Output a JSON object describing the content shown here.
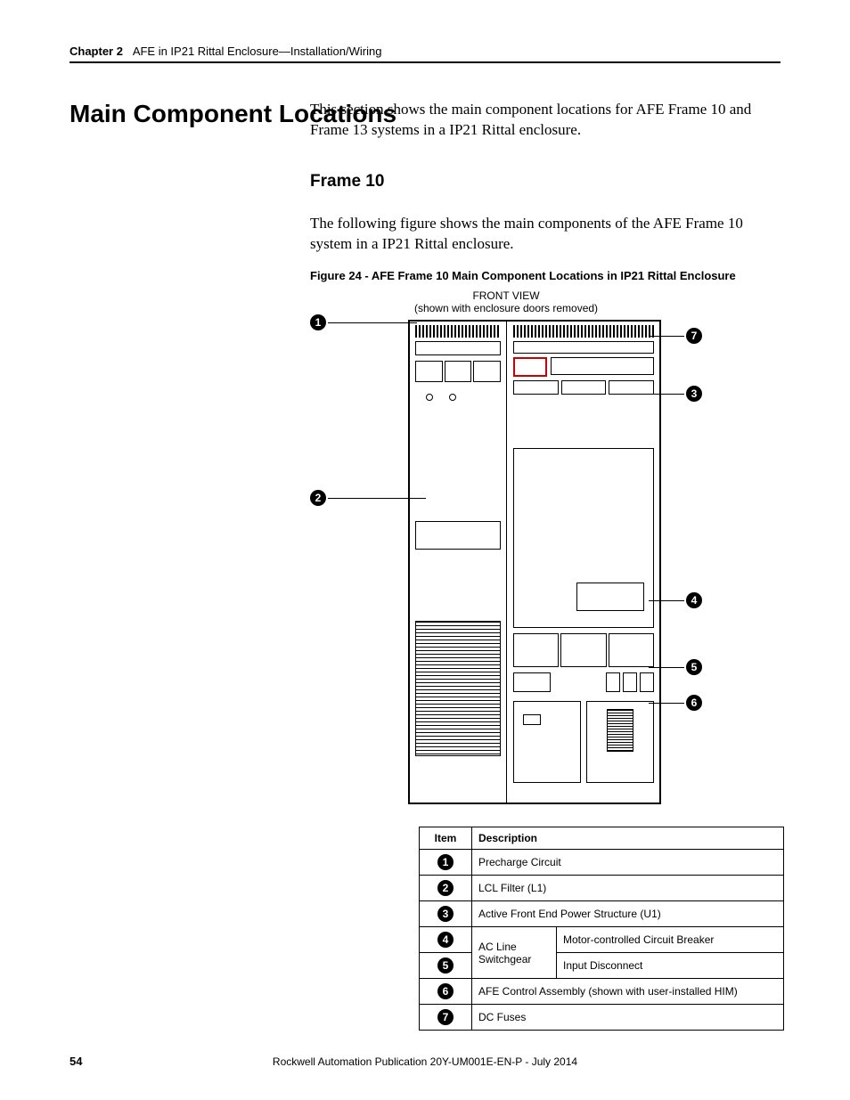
{
  "header": {
    "chapter_label": "Chapter 2",
    "chapter_title": "AFE in IP21 Rittal Enclosure—Installation/Wiring"
  },
  "section_title": "Main Component Locations",
  "intro_text": "This section shows the main component locations for AFE Frame 10 and Frame 13 systems in a IP21 Rittal enclosure.",
  "subsection_title": "Frame 10",
  "subsection_text": "The following figure shows the main components of the AFE Frame 10 system in a IP21 Rittal enclosure.",
  "figure_caption": "Figure 24 - AFE Frame 10 Main Component Locations in IP21 Rittal Enclosure",
  "figure_title": "FRONT VIEW",
  "figure_subtitle": "(shown with enclosure doors removed)",
  "callouts": {
    "c1": "1",
    "c2": "2",
    "c3": "3",
    "c4": "4",
    "c5": "5",
    "c6": "6",
    "c7": "7"
  },
  "table": {
    "headers": {
      "item": "Item",
      "desc": "Description"
    },
    "rows": [
      {
        "n": "1",
        "desc": "Precharge Circuit"
      },
      {
        "n": "2",
        "desc": "LCL Filter (L1)"
      },
      {
        "n": "3",
        "desc": "Active Front End Power Structure (U1)"
      }
    ],
    "switchgear_label": "AC Line Switchgear",
    "row4": {
      "n": "4",
      "desc": "Motor-controlled Circuit Breaker"
    },
    "row5": {
      "n": "5",
      "desc": "Input Disconnect"
    },
    "row6": {
      "n": "6",
      "desc": "AFE Control Assembly (shown with user-installed HIM)"
    },
    "row7": {
      "n": "7",
      "desc": "DC Fuses"
    }
  },
  "footer": {
    "page": "54",
    "publication": "Rockwell Automation Publication 20Y-UM001E-EN-P - July 2014"
  }
}
